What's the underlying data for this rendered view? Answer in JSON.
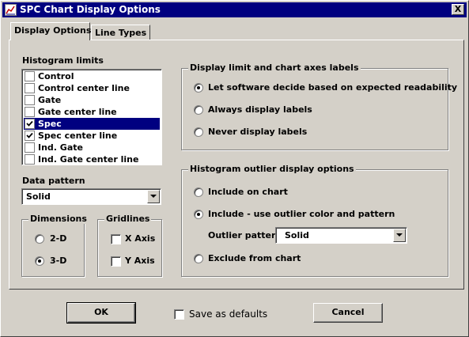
{
  "window": {
    "title": "SPC Chart Display Options",
    "close_label": "X"
  },
  "tabs": [
    {
      "label": "Display Options",
      "active": true
    },
    {
      "label": "Line Types",
      "active": false
    }
  ],
  "histogram_limits": {
    "label": "Histogram limits",
    "items": [
      {
        "label": "Control",
        "checked": false,
        "selected": false
      },
      {
        "label": "Control center line",
        "checked": false,
        "selected": false
      },
      {
        "label": "Gate",
        "checked": false,
        "selected": false
      },
      {
        "label": "Gate center line",
        "checked": false,
        "selected": false
      },
      {
        "label": "Spec",
        "checked": true,
        "selected": true
      },
      {
        "label": "Spec center line",
        "checked": true,
        "selected": false
      },
      {
        "label": "Ind. Gate",
        "checked": false,
        "selected": false
      },
      {
        "label": "Ind. Gate center line",
        "checked": false,
        "selected": false
      }
    ]
  },
  "data_pattern": {
    "label": "Data pattern",
    "value": "Solid"
  },
  "dimensions": {
    "title": "Dimensions",
    "options": [
      {
        "label": "2-D",
        "selected": false
      },
      {
        "label": "3-D",
        "selected": true
      }
    ]
  },
  "gridlines": {
    "title": "Gridlines",
    "options": [
      {
        "label": "X Axis",
        "checked": false
      },
      {
        "label": "Y Axis",
        "checked": false
      }
    ]
  },
  "axes_labels": {
    "title": "Display limit and chart axes labels",
    "options": [
      {
        "label": "Let software decide based on expected readability",
        "selected": true
      },
      {
        "label": "Always display labels",
        "selected": false
      },
      {
        "label": "Never display labels",
        "selected": false
      }
    ]
  },
  "outlier": {
    "title": "Histogram outlier display options",
    "options": [
      {
        "label": "Include on chart",
        "selected": false
      },
      {
        "label": "Include - use outlier color and pattern",
        "selected": true
      },
      {
        "label": "Exclude from chart",
        "selected": false
      }
    ],
    "pattern_label": "Outlier pattern",
    "pattern_value": "Solid"
  },
  "footer": {
    "ok_label": "OK",
    "save_defaults_label": "Save as defaults",
    "save_defaults_checked": false,
    "cancel_label": "Cancel"
  },
  "colors": {
    "titlebar": "#000080",
    "face": "#d4d0c8",
    "selection": "#000080"
  }
}
